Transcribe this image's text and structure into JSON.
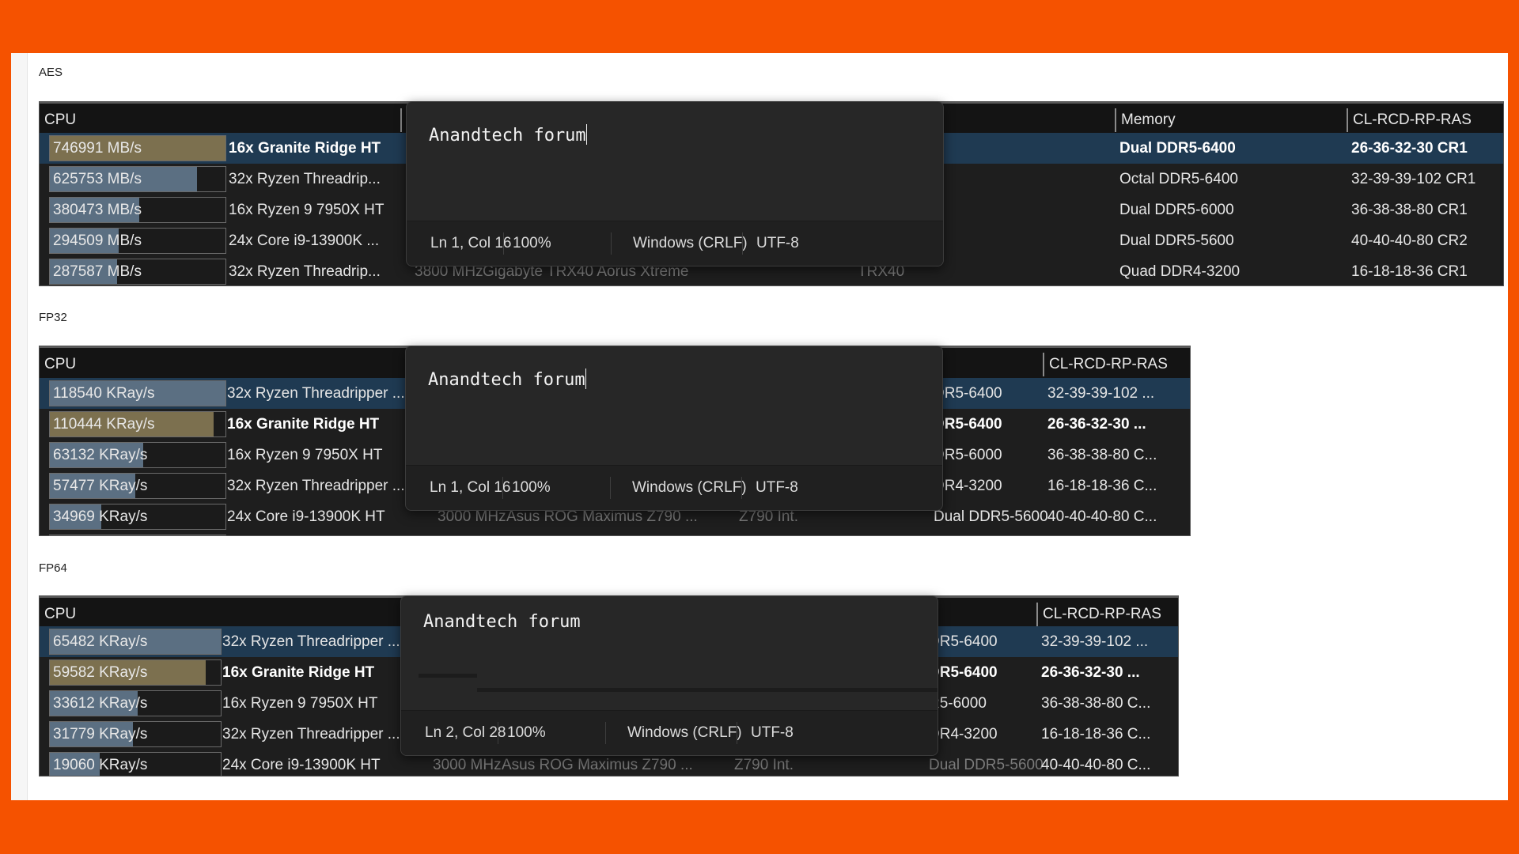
{
  "colors": {
    "background": "#f55200",
    "card": "#ffffff",
    "table_bg": "#1e1e1e",
    "header_bg": "#141414",
    "selected_row": "#1f3a52",
    "bar_highlight": "#7c704f",
    "bar_default": "#5b6f82",
    "popup_bg": "#272727"
  },
  "sections": [
    {
      "label": "AES",
      "columns": {
        "cpu": "CPU",
        "memory": "Memory",
        "timings": "CL-RCD-RP-RAS"
      },
      "popup": {
        "text": "Anandtech forum",
        "status": {
          "position": "Ln 1, Col 16",
          "zoom": "100%",
          "line_ending": "Windows (CRLF)",
          "encoding": "UTF-8"
        }
      },
      "rows": [
        {
          "score": "746991 MB/s",
          "fill": 1.0,
          "highlight": true,
          "selected": true,
          "bold": true,
          "cpu": "16x Granite Ridge HT",
          "clock": "",
          "board": "",
          "chipset": "",
          "memory": "Dual DDR5-6400",
          "timings": "26-36-32-30 CR1"
        },
        {
          "score": "625753 MB/s",
          "fill": 0.838,
          "highlight": false,
          "selected": false,
          "bold": false,
          "cpu": "32x Ryzen Threadrip...",
          "clock": "",
          "board": "",
          "chipset": "",
          "memory": "Octal DDR5-6400",
          "timings": "32-39-39-102 CR1"
        },
        {
          "score": "380473 MB/s",
          "fill": 0.509,
          "highlight": false,
          "selected": false,
          "bold": false,
          "cpu": "16x Ryzen 9 7950X HT",
          "clock": "",
          "board": "",
          "chipset": "",
          "memory": "Dual DDR5-6000",
          "timings": "36-38-38-80 CR1"
        },
        {
          "score": "294509 MB/s",
          "fill": 0.394,
          "highlight": false,
          "selected": false,
          "bold": false,
          "cpu": "24x Core i9-13900K ...",
          "clock": "",
          "board": "",
          "chipset": "",
          "memory": "Dual DDR5-5600",
          "timings": "40-40-40-80 CR2"
        },
        {
          "score": "287587 MB/s",
          "fill": 0.385,
          "highlight": false,
          "selected": false,
          "bold": false,
          "cpu": "32x Ryzen Threadrip...",
          "clock": "3800 MHz",
          "board": "Gigabyte TRX40 Aorus Xtreme",
          "chipset": "TRX40",
          "memory": "Quad DDR4-3200",
          "timings": "16-18-18-36 CR1"
        }
      ]
    },
    {
      "label": "FP32",
      "columns": {
        "cpu": "CPU",
        "memory": "",
        "timings": "CL-RCD-RP-RAS"
      },
      "popup": {
        "text": "Anandtech forum",
        "status": {
          "position": "Ln 1, Col 16",
          "zoom": "100%",
          "line_ending": "Windows (CRLF)",
          "encoding": "UTF-8"
        }
      },
      "rows": [
        {
          "score": "118540 KRay/s",
          "fill": 1.0,
          "highlight": false,
          "selected": true,
          "bold": false,
          "cpu": "32x Ryzen Threadripper ...",
          "clock": "",
          "board": "",
          "chipset": "",
          "memory": "DR5-6400",
          "timings": "32-39-39-102 ..."
        },
        {
          "score": "110444 KRay/s",
          "fill": 0.932,
          "highlight": true,
          "selected": false,
          "bold": true,
          "cpu": "16x Granite Ridge HT",
          "clock": "",
          "board": "",
          "chipset": "",
          "memory": "DR5-6400",
          "timings": "26-36-32-30 ..."
        },
        {
          "score": "63132 KRay/s",
          "fill": 0.533,
          "highlight": false,
          "selected": false,
          "bold": false,
          "cpu": "16x Ryzen 9 7950X HT",
          "clock": "",
          "board": "",
          "chipset": "",
          "memory": "DR5-6000",
          "timings": "36-38-38-80 C..."
        },
        {
          "score": "57477 KRay/s",
          "fill": 0.485,
          "highlight": false,
          "selected": false,
          "bold": false,
          "cpu": "32x Ryzen Threadripper ...",
          "clock": "",
          "board": "",
          "chipset": "",
          "memory": "DR4-3200",
          "timings": "16-18-18-36 C..."
        },
        {
          "score": "34969 KRay/s",
          "fill": 0.295,
          "highlight": false,
          "selected": false,
          "bold": false,
          "cpu": "24x Core i9-13900K HT",
          "clock": "3000 MHz",
          "board": "Asus ROG Maximus Z790 ...",
          "chipset": "Z790 Int.",
          "memory": "Dual DDR5-5600",
          "timings": "40-40-40-80 C..."
        },
        {
          "score": "",
          "fill": 0.2,
          "highlight": false,
          "selected": false,
          "bold": false,
          "cpu": "",
          "clock": "",
          "board": "",
          "chipset": "",
          "memory": "",
          "timings": ""
        }
      ]
    },
    {
      "label": "FP64",
      "columns": {
        "cpu": "CPU",
        "memory": "",
        "timings": "CL-RCD-RP-RAS"
      },
      "popup": {
        "text": "Anandtech forum",
        "status": {
          "position": "Ln 2, Col 28",
          "zoom": "100%",
          "line_ending": "Windows (CRLF)",
          "encoding": "UTF-8"
        }
      },
      "rows": [
        {
          "score": "65482 KRay/s",
          "fill": 1.0,
          "highlight": false,
          "selected": true,
          "bold": false,
          "cpu": "32x Ryzen Threadripper ...",
          "clock": "",
          "board": "",
          "chipset": "",
          "memory": "DR5-6400",
          "timings": "32-39-39-102 ..."
        },
        {
          "score": "59582 KRay/s",
          "fill": 0.91,
          "highlight": true,
          "selected": false,
          "bold": true,
          "cpu": "16x Granite Ridge HT",
          "clock": "",
          "board": "",
          "chipset": "",
          "memory": "DR5-6400",
          "timings": "26-36-32-30 ..."
        },
        {
          "score": "33612 KRay/s",
          "fill": 0.513,
          "highlight": false,
          "selected": false,
          "bold": false,
          "cpu": "16x Ryzen 9 7950X HT",
          "clock": "",
          "board": "",
          "chipset": "",
          "memory": "R5-6000",
          "timings": "36-38-38-80 C..."
        },
        {
          "score": "31779 KRay/s",
          "fill": 0.485,
          "highlight": false,
          "selected": false,
          "bold": false,
          "cpu": "32x Ryzen Threadripper ...",
          "clock": "",
          "board": "",
          "chipset": "",
          "memory": "DR4-3200",
          "timings": "16-18-18-36 C..."
        },
        {
          "score": "19060 KRay/s",
          "fill": 0.291,
          "highlight": false,
          "selected": false,
          "bold": false,
          "cpu": "24x Core i9-13900K HT",
          "clock": "3000 MHz",
          "board": "Asus ROG Maximus Z790 ...",
          "chipset": "Z790 Int.",
          "memory": "Dual DDR5-5600",
          "timings": "40-40-40-80 C..."
        }
      ]
    }
  ]
}
